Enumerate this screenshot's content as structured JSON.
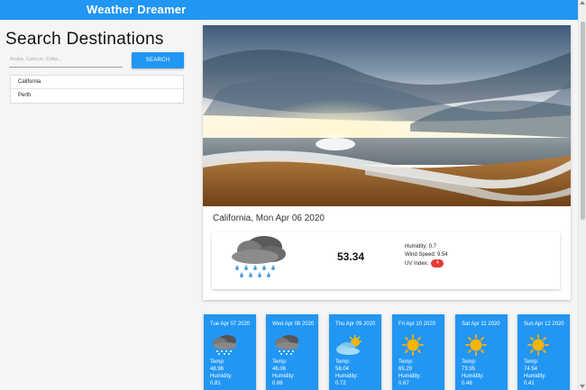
{
  "app": {
    "title": "Weather Dreamer",
    "accent_color": "#2196f3"
  },
  "search": {
    "title": "Search Destinations",
    "placeholder": "Aruba, Cancun, Cuba...",
    "button_label": "SEARCH",
    "history": [
      "California",
      "Perth"
    ]
  },
  "current": {
    "city_date": "California, Mon Apr 06 2020",
    "icon": "rain-cloud-icon",
    "temp": "53.34",
    "humidity": "Humidity: 0.7",
    "wind_speed": "Wind Speed: 9.54",
    "uv_label": "UV Index:",
    "uv_value": "4",
    "uv_color": "#e53935"
  },
  "forecast": [
    {
      "date": "Tue Apr 07 2020",
      "icon": "snow-cloud-icon",
      "temp_label": "Temp:",
      "temp": "48.96",
      "humidity_label": "Humidity:",
      "humidity": "0.81"
    },
    {
      "date": "Wed Apr 08 2020",
      "icon": "snow-cloud-icon",
      "temp_label": "Temp:",
      "temp": "46.06",
      "humidity_label": "Humidity:",
      "humidity": "0.86"
    },
    {
      "date": "Thu Apr 09 2020",
      "icon": "partly-cloudy-icon",
      "temp_label": "Temp:",
      "temp": "56.04",
      "humidity_label": "Humidity:",
      "humidity": "0.72"
    },
    {
      "date": "Fri Apr 10 2020",
      "icon": "sun-icon",
      "temp_label": "Temp:",
      "temp": "65.29",
      "humidity_label": "Humidity:",
      "humidity": "0.67"
    },
    {
      "date": "Sat Apr 11 2020",
      "icon": "sun-icon",
      "temp_label": "Temp:",
      "temp": "73.95",
      "humidity_label": "Humidity:",
      "humidity": "0.48"
    },
    {
      "date": "Sun Apr 12 2020",
      "icon": "sun-icon",
      "temp_label": "Temp:",
      "temp": "74.54",
      "humidity_label": "Humidity:",
      "humidity": "0.41"
    }
  ]
}
